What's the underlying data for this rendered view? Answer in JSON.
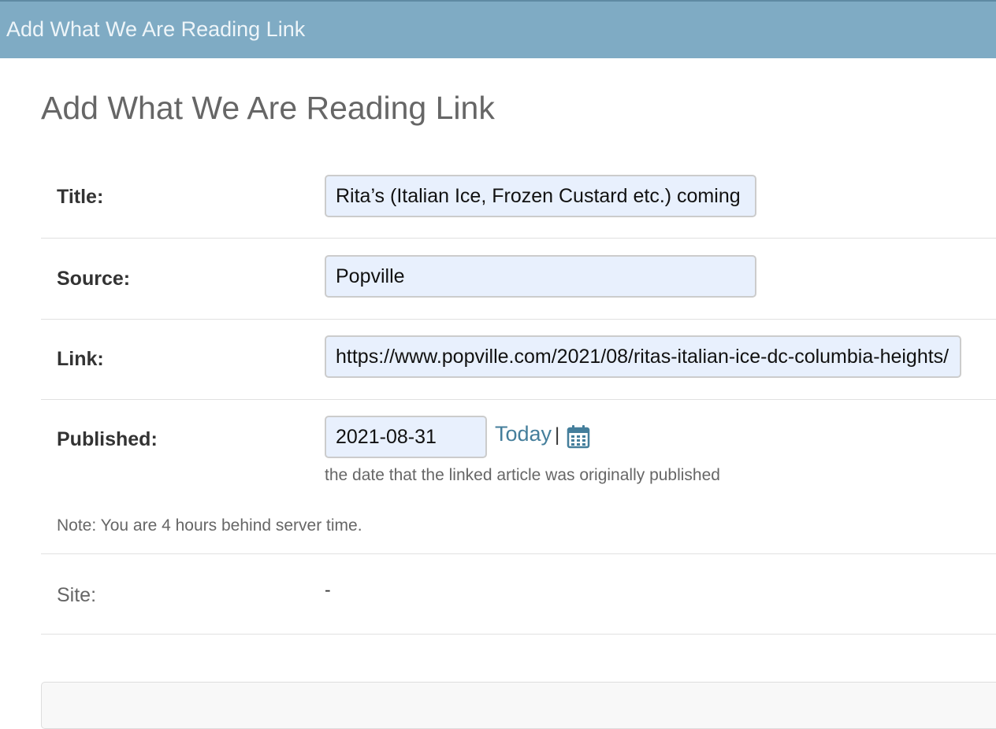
{
  "header": {
    "title": "Add What We Are Reading Link"
  },
  "page": {
    "title": "Add What We Are Reading Link"
  },
  "form": {
    "title": {
      "label": "Title:",
      "value": "Rita’s (Italian Ice, Frozen Custard etc.) coming to Columbia Heights"
    },
    "source": {
      "label": "Source:",
      "value": "Popville"
    },
    "link": {
      "label": "Link:",
      "value": "https://www.popville.com/2021/08/ritas-italian-ice-dc-columbia-heights/"
    },
    "published": {
      "label": "Published:",
      "value": "2021-08-31",
      "today_label": "Today",
      "separator": "|",
      "calendar_icon": "calendar-icon",
      "help_text": "the date that the linked article was originally published",
      "timezone_note": "Note: You are 4 hours behind server time."
    },
    "site": {
      "label": "Site:",
      "value": "-"
    }
  },
  "colors": {
    "header_bg": "#7fabc4",
    "link_color": "#447e9b",
    "input_bg": "#e8f0fd"
  }
}
